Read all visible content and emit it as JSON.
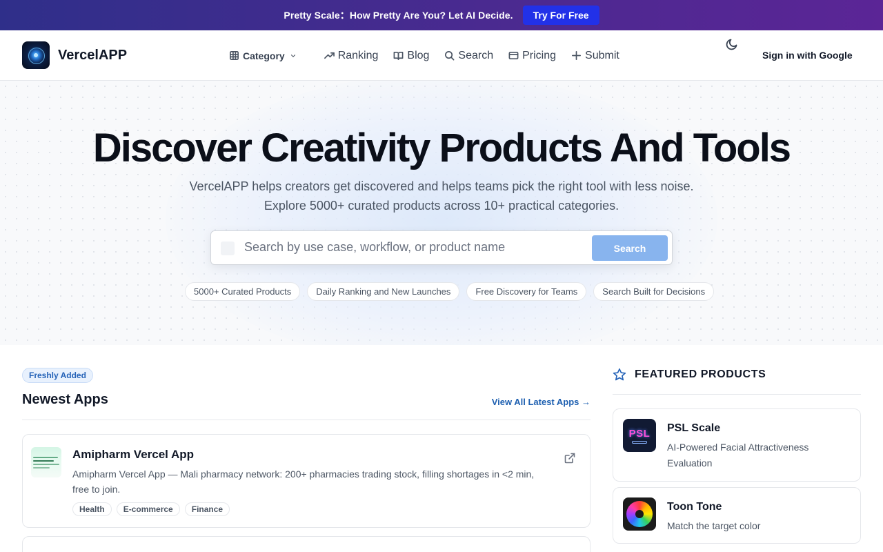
{
  "promo": {
    "text": "Pretty Scale：How Pretty Are You? Let AI Decide.",
    "cta": "Try For Free"
  },
  "header": {
    "brand": "VercelAPP",
    "nav": [
      {
        "label": "Category",
        "icon": "grid-icon"
      },
      {
        "label": "Ranking",
        "icon": "trending-up-icon"
      },
      {
        "label": "Blog",
        "icon": "book-open-icon"
      },
      {
        "label": "Search",
        "icon": "search-icon"
      },
      {
        "label": "Pricing",
        "icon": "credit-card-icon"
      },
      {
        "label": "Submit",
        "icon": "plus-icon"
      }
    ],
    "theme_icon": "moon-icon",
    "sign_in": "Sign in with Google"
  },
  "hero": {
    "title": "Discover Creativity Products And Tools",
    "subtitle_line1": "VercelAPP helps creators get discovered and helps teams pick the right tool with less noise.",
    "subtitle_line2": "Explore 5000+ curated products across 10+ practical categories.",
    "search_placeholder": "Search by use case, workflow, or product name",
    "search_button": "Search",
    "chips": [
      "5000+ Curated Products",
      "Daily Ranking and New Launches",
      "Free Discovery for Teams",
      "Search Built for Decisions"
    ]
  },
  "newest": {
    "badge": "Freshly Added",
    "title": "Newest Apps",
    "view_all": "View All Latest Apps →",
    "apps": [
      {
        "name": "Amipharm Vercel App",
        "description": "Amipharm Vercel App — Mali pharmacy network: 200+ pharmacies trading stock, filling shortages in <2 min, free to join.",
        "tags": [
          "Health",
          "E-commerce",
          "Finance"
        ]
      }
    ]
  },
  "featured": {
    "title": "FEATURED PRODUCTS",
    "items": [
      {
        "name": "PSL Scale",
        "description": "AI-Powered Facial Attractiveness Evaluation",
        "logo_text": "PSL"
      },
      {
        "name": "Toon Tone",
        "description": "Match the target color"
      }
    ]
  },
  "colors": {
    "promo_start": "#2f2f8a",
    "promo_end": "#5b2596",
    "promo_button": "#2231e8",
    "search_button": "#88b4ee",
    "link": "#1d5fb0",
    "badge_bg": "#e8f1fd"
  }
}
